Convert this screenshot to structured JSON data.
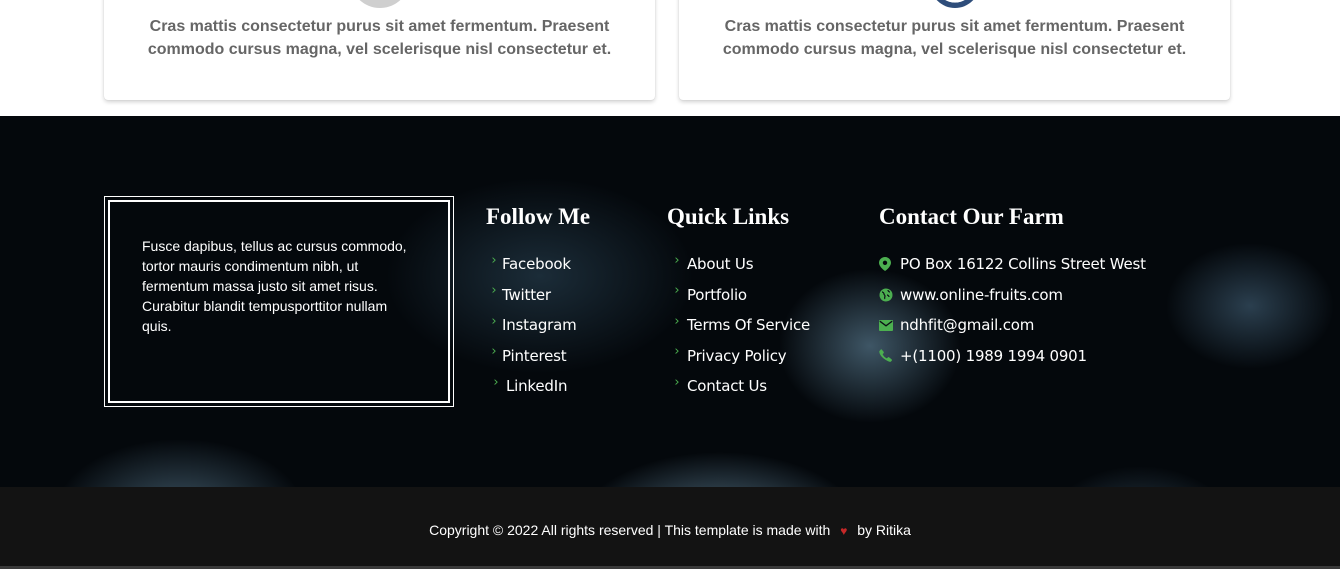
{
  "cards": [
    {
      "text": "Cras mattis consectetur purus sit amet fermentum. Praesent commodo cursus magna, vel scelerisque nisl consectetur et."
    },
    {
      "text": "Cras mattis consectetur purus sit amet fermentum. Praesent commodo cursus magna, vel scelerisque nisl consectetur et."
    }
  ],
  "footer": {
    "about_text": "Fusce dapibus, tellus ac cursus commodo, tortor mauris condimentum nibh, ut fermentum massa justo sit amet risus. Curabitur blandit tempusporttitor nullam quis.",
    "follow": {
      "title": "Follow Me",
      "items": [
        "Facebook",
        "Twitter",
        "Instagram",
        "Pinterest",
        "LinkedIn"
      ]
    },
    "quick": {
      "title": "Quick Links",
      "items": [
        "About Us",
        "Portfolio",
        "Terms Of Service",
        "Privacy Policy",
        "Contact Us"
      ]
    },
    "contact": {
      "title": "Contact Our Farm",
      "address": "PO Box 16122 Collins Street West",
      "website": "www.online-fruits.com",
      "email": "ndhfit@gmail.com",
      "phone": "+(1100) 1989 1994 0901",
      "icons": [
        "map-pin-icon",
        "globe-icon",
        "mail-icon",
        "phone-icon"
      ]
    },
    "copyright": {
      "before": "Copyright © 2022 All rights reserved | This template is made with",
      "after": "by Ritika"
    }
  },
  "colors": {
    "accent": "#4caf50",
    "heart": "#c62828",
    "copyright_bg": "#131313"
  }
}
